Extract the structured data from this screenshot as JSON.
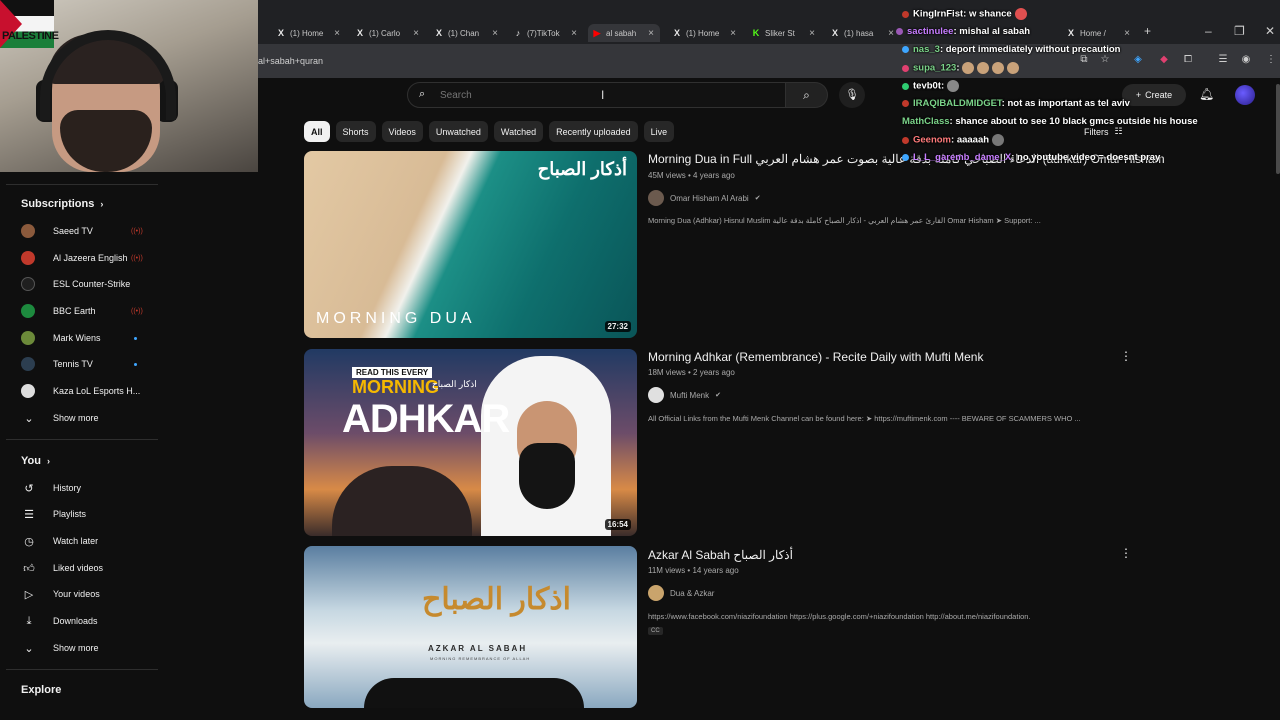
{
  "tabs": [
    {
      "label": "(1) Home",
      "icon": "X"
    },
    {
      "label": "(1) Carlo",
      "icon": "X"
    },
    {
      "label": "(1) Chan",
      "icon": "X"
    },
    {
      "label": "(7)TikTok",
      "icon": "♪"
    },
    {
      "label": "al sabah",
      "icon": "▶",
      "active": true
    },
    {
      "label": "(1) Home",
      "icon": "X"
    },
    {
      "label": "Sliker St",
      "icon": "K"
    },
    {
      "label": "(1) hasa",
      "icon": "X"
    },
    {
      "label": "Home /",
      "icon": "X"
    }
  ],
  "address": {
    "text": "al+sabah+quran"
  },
  "webcam": {
    "flag_text": "PALESTINE"
  },
  "header": {
    "search_placeholder": "Search",
    "create_label": "Create"
  },
  "chips": [
    "All",
    "Shorts",
    "Videos",
    "Unwatched",
    "Watched",
    "Recently uploaded",
    "Live"
  ],
  "filters_label": "Filters",
  "sidebar": {
    "subscriptions_title": "Subscriptions",
    "subscriptions": [
      {
        "label": "Saeed TV",
        "color": "#8b5a3c",
        "live": true
      },
      {
        "label": "Al Jazeera English",
        "color": "#c0392b",
        "live": true
      },
      {
        "label": "ESL Counter-Strike",
        "color": "#1f1f1f",
        "live": false
      },
      {
        "label": "BBC Earth",
        "color": "#1d8a3e",
        "live": true
      },
      {
        "label": "Mark Wiens",
        "color": "#6c8a3a",
        "new": true
      },
      {
        "label": "Tennis TV",
        "color": "#2c3e50",
        "new": true
      },
      {
        "label": "Kaza LoL Esports H...",
        "color": "#ddd",
        "live": false
      }
    ],
    "show_more_1": "Show more",
    "you_title": "You",
    "you_items": [
      {
        "label": "History",
        "icon": "history-icon"
      },
      {
        "label": "Playlists",
        "icon": "playlists-icon"
      },
      {
        "label": "Watch later",
        "icon": "clock-icon"
      },
      {
        "label": "Liked videos",
        "icon": "thumbs-up-icon"
      },
      {
        "label": "Your videos",
        "icon": "play-box-icon"
      },
      {
        "label": "Downloads",
        "icon": "download-icon"
      }
    ],
    "show_more_2": "Show more",
    "explore_title": "Explore"
  },
  "results": [
    {
      "title": "Morning Dua in Full الدعاء الصباحي كاملة بدقة عالية بصوت عمر هشام العربي (adhkar) Omar Hisham",
      "meta": "45M views • 4 years ago",
      "channel": "Omar Hisham Al Arabi",
      "verified": true,
      "desc": "Morning Dua (Adhkar) Hisnul Muslim القارئ عمر هشام العربي - اذكار الصباح كاملة بدقة عالية Omar Hisham ➤ Support: ...",
      "duration": "27:32",
      "thumb_ar": "أذكار الصباح",
      "thumb_en": "MORNING DUA"
    },
    {
      "title": "Morning Adhkar (Remembrance) - Recite Daily with Mufti Menk",
      "meta": "18M views • 2 years ago",
      "channel": "Mufti Menk",
      "verified": true,
      "desc": "All Official Links from the Mufti Menk Channel can be found here: ➤ https://muftimenk.com ---- BEWARE OF SCAMMERS WHO ...",
      "duration": "16:54",
      "thumb_read": "READ THIS EVERY",
      "thumb_morning": "MORNING",
      "thumb_adhkar": "ADHKAR",
      "thumb_ar": "اذكار الصباح"
    },
    {
      "title": "Azkar Al Sabah أذكار الصباح",
      "meta": "11M views • 14 years ago",
      "channel": "Dua & Azkar",
      "verified": false,
      "desc": "https://www.facebook.com/niazifoundation https://plus.google.com/+niazifoundation http://about.me/niazifoundation.",
      "cc": "CC",
      "thumb_ar": "اذكار الصباح",
      "thumb_en": "AZKAR AL SABAH",
      "thumb_sub": "MORNING REMEMBRANCE OF ALLAH"
    }
  ],
  "chat": [
    {
      "user": "KingIrnFist",
      "msg": ": w shance",
      "color": "#ffffff"
    },
    {
      "user": "sactinulee",
      "msg": ": mishal al sabah",
      "color": "#c77dff"
    },
    {
      "user": "nas_3",
      "msg": ": deport immediately without precaution",
      "color": "#7bd389"
    },
    {
      "user": "supa_123",
      "msg": ":",
      "color": "#7bd389"
    },
    {
      "user": "tevb0t",
      "msg": ":",
      "color": "#ffffff"
    },
    {
      "user": "IRAQIBALDMIDGET",
      "msg": ": not as important as tel aviv",
      "color": "#7bd389"
    },
    {
      "user": "MathClass",
      "msg": ": shance about to see 10 black gmcs outside his house",
      "color": "#7bd389"
    },
    {
      "user": "Geenom",
      "msg": ": aaaaah",
      "color": "#ff7b7b"
    },
    {
      "user": "L_L_garemb_dame_X",
      "msg": ": no youtube video = doesnt pray",
      "color": "#c77dff"
    }
  ]
}
